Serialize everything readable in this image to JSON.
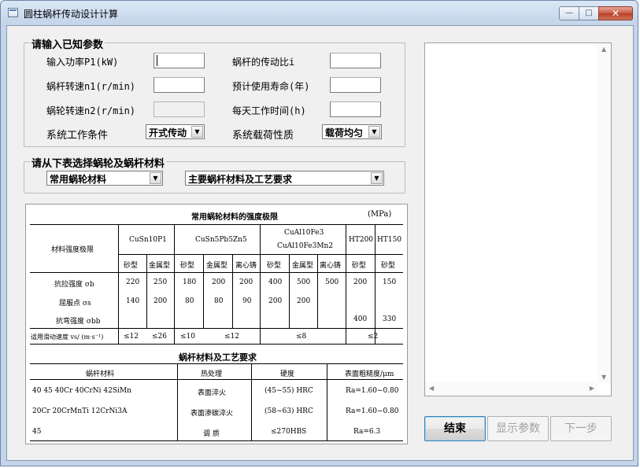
{
  "window": {
    "title": "圆柱蜗杆传动设计计算",
    "minimize": "—",
    "maximize": "□",
    "close": "✕"
  },
  "known_params": {
    "group_title": "请输入已知参数",
    "fields": [
      {
        "label": "输入功率P1(kW)",
        "value": ""
      },
      {
        "label": "蜗杆转速n1(r/min)",
        "value": ""
      },
      {
        "label": "蜗轮转速n2(r/min)",
        "value": ""
      },
      {
        "label": "蜗杆的传动比i",
        "value": ""
      },
      {
        "label": "预计使用寿命(年)",
        "value": ""
      },
      {
        "label": "每天工作时间(h)",
        "value": ""
      }
    ],
    "work_condition_label": "系统工作条件",
    "work_condition_value": "开式传动",
    "load_nature_label": "系统载荷性质",
    "load_nature_value": "载荷均匀"
  },
  "material_select": {
    "group_title": "请从下表选择蜗轮及蜗杆材料",
    "wheel_material_value": "常用蜗轮材料",
    "worm_material_value": "主要蜗杆材料及工艺要求"
  },
  "table_image": {
    "title1": "常用蜗轮材料的强度极限",
    "unit": "(MPa)",
    "row_header": "材料强度极限",
    "materials": [
      "CuSn10P1",
      "CuSn5Pb5Zn5",
      "CuAl10Fe3",
      "CuAl10Fe3Mn2",
      "HT200",
      "HT150"
    ],
    "cast_types": [
      "砂型",
      "金属型",
      "砂型",
      "金属型",
      "离心铸",
      "砂型",
      "金属型",
      "离心铸",
      "砂型",
      "砂型"
    ],
    "rows": [
      {
        "label": "抗拉强度 σb",
        "values": [
          "220",
          "250",
          "180",
          "200",
          "200",
          "400",
          "500",
          "500",
          "200",
          "150"
        ]
      },
      {
        "label": "屈服点 σs",
        "values": [
          "140",
          "200",
          "80",
          "80",
          "90",
          "200",
          "200",
          "",
          "",
          ""
        ]
      },
      {
        "label": "抗弯强度 σbb",
        "values": [
          "",
          "",
          "",
          "",
          "",
          "",
          "",
          "",
          "400",
          "330"
        ]
      }
    ],
    "speed_label": "适用滑动速度 vs/ (m·s⁻¹)",
    "speed_values": [
      "≤12",
      "≤26",
      "≤10",
      "≤12",
      "≤8",
      "≤2"
    ],
    "title2": "蜗杆材料及工艺要求",
    "headers2": [
      "蜗杆材料",
      "热处理",
      "硬度",
      "表面粗糙度/μm"
    ],
    "rows2": [
      [
        "40  45  40Cr  40CrNi  42SiMn",
        "表面淬火",
        "(45~55) HRC",
        "Ra=1.60~0.80"
      ],
      [
        "20Cr  20CrMnTi  12CrNi3A",
        "表面渗碳淬火",
        "(58~63) HRC",
        "Ra=1.60~0.80"
      ],
      [
        "45",
        "调  质",
        "≤270HBS",
        "Ra=6.3"
      ]
    ]
  },
  "buttons": {
    "finish": "结束",
    "show_params": "显示参数",
    "next": "下一步"
  }
}
